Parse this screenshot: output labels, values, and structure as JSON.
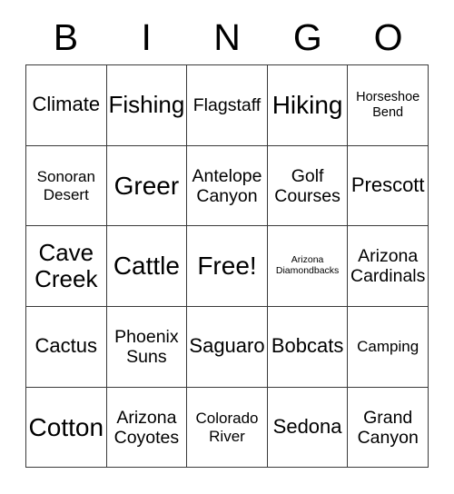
{
  "card": {
    "header_letters": [
      "B",
      "I",
      "N",
      "G",
      "O"
    ],
    "rows": [
      [
        {
          "text": "Climate",
          "size": "md"
        },
        {
          "text": "Fishing",
          "size": "lg"
        },
        {
          "text": "Flagstaff",
          "size": "sm"
        },
        {
          "text": "Hiking",
          "size": "xl"
        },
        {
          "text": "Horseshoe\nBend",
          "size": "xxs"
        }
      ],
      [
        {
          "text": "Sonoran\nDesert",
          "size": "xs"
        },
        {
          "text": "Greer",
          "size": "xl"
        },
        {
          "text": "Antelope\nCanyon",
          "size": "sm"
        },
        {
          "text": "Golf\nCourses",
          "size": "sm"
        },
        {
          "text": "Prescott",
          "size": "md"
        }
      ],
      [
        {
          "text": "Cave\nCreek",
          "size": "lg"
        },
        {
          "text": "Cattle",
          "size": "xl"
        },
        {
          "text": "Free!",
          "size": "xl"
        },
        {
          "text": "Arizona\nDiamondbacks",
          "size": "tiny"
        },
        {
          "text": "Arizona\nCardinals",
          "size": "sm"
        }
      ],
      [
        {
          "text": "Cactus",
          "size": "md"
        },
        {
          "text": "Phoenix\nSuns",
          "size": "sm"
        },
        {
          "text": "Saguaro",
          "size": "md"
        },
        {
          "text": "Bobcats",
          "size": "md"
        },
        {
          "text": "Camping",
          "size": "xs"
        }
      ],
      [
        {
          "text": "Cotton",
          "size": "xl"
        },
        {
          "text": "Arizona\nCoyotes",
          "size": "sm"
        },
        {
          "text": "Colorado\nRiver",
          "size": "xs"
        },
        {
          "text": "Sedona",
          "size": "md"
        },
        {
          "text": "Grand\nCanyon",
          "size": "sm"
        }
      ]
    ]
  }
}
